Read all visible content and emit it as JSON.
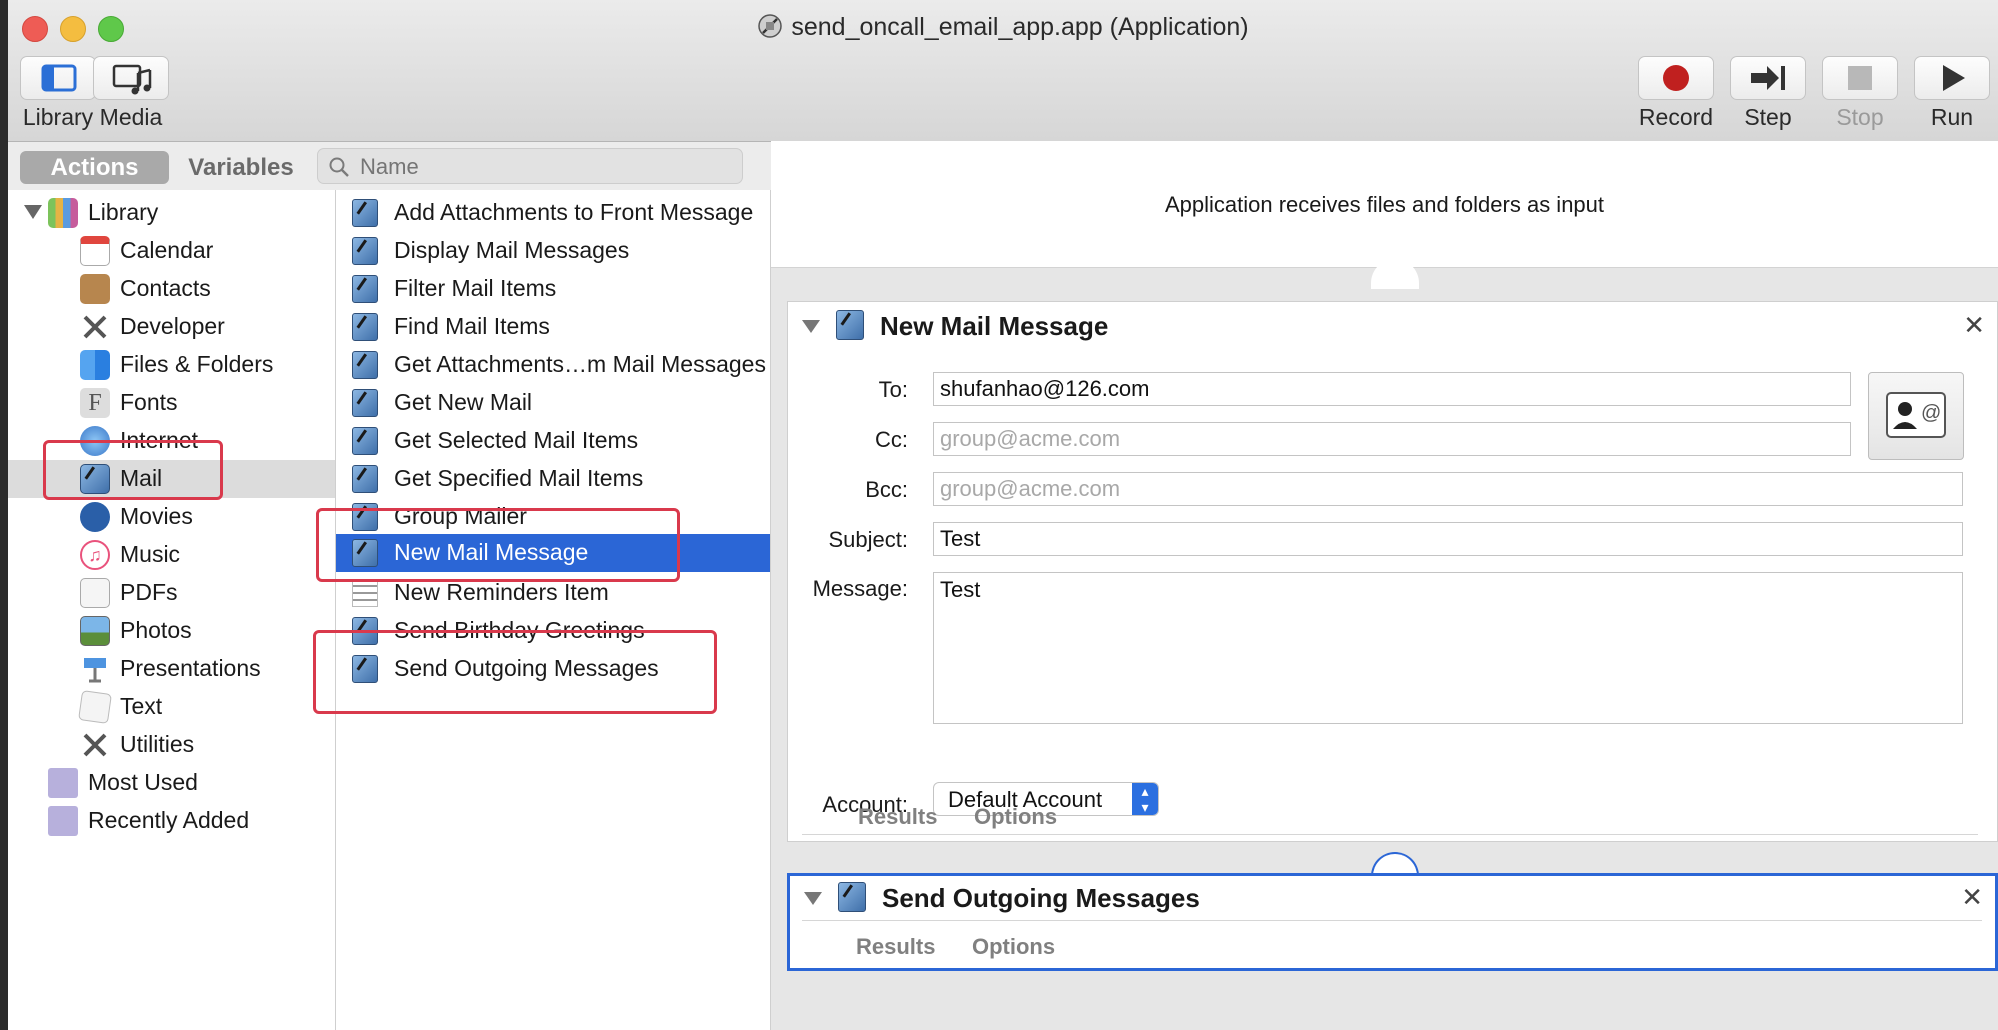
{
  "window": {
    "title": "send_oncall_email_app.app (Application)"
  },
  "toolbar": {
    "library_label": "Library",
    "media_label": "Media",
    "record_label": "Record",
    "step_label": "Step",
    "stop_label": "Stop",
    "run_label": "Run"
  },
  "tabs": {
    "actions": "Actions",
    "variables": "Variables"
  },
  "search": {
    "placeholder": "Name"
  },
  "library": {
    "root": "Library",
    "items": [
      "Calendar",
      "Contacts",
      "Developer",
      "Files & Folders",
      "Fonts",
      "Internet",
      "Mail",
      "Movies",
      "Music",
      "PDFs",
      "Photos",
      "Presentations",
      "Text",
      "Utilities"
    ],
    "selected": "Mail",
    "smart": [
      "Most Used",
      "Recently Added"
    ]
  },
  "actions": {
    "items": [
      "Add Attachments to Front Message",
      "Display Mail Messages",
      "Filter Mail Items",
      "Find Mail Items",
      "Get Attachments…m Mail Messages",
      "Get New Mail",
      "Get Selected Mail Items",
      "Get Specified Mail Items",
      "Group Mailer",
      "New Mail Message",
      "New Reminders Item",
      "Send Birthday Greetings",
      "Send Outgoing Messages"
    ],
    "selected": "New Mail Message"
  },
  "workflow": {
    "input_text": "Application receives files and folders as input",
    "new_mail": {
      "title": "New Mail Message",
      "to_label": "To:",
      "to_value": "shufanhao@126.com",
      "cc_label": "Cc:",
      "cc_placeholder": "group@acme.com",
      "bcc_label": "Bcc:",
      "bcc_placeholder": "group@acme.com",
      "subject_label": "Subject:",
      "subject_value": "Test",
      "message_label": "Message:",
      "message_value": "Test",
      "account_label": "Account:",
      "account_value": "Default Account",
      "results_label": "Results",
      "options_label": "Options"
    },
    "send_outgoing": {
      "title": "Send Outgoing Messages",
      "results_label": "Results",
      "options_label": "Options"
    }
  },
  "colors": {
    "selection": "#2b66d6",
    "annotation": "#d9394c",
    "record": "#c0201f"
  }
}
